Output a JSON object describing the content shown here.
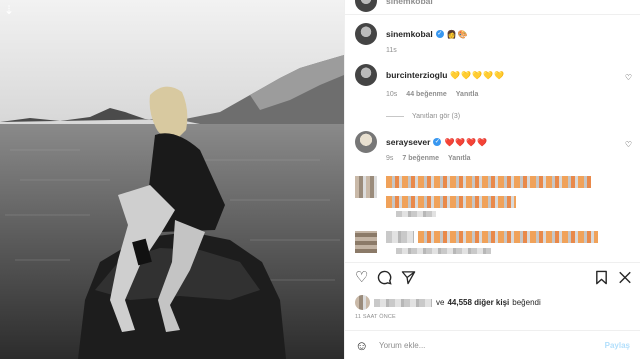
{
  "post": {
    "author": "sinemkobal",
    "author_badges": "👩🎨",
    "caption_time": "11s",
    "top_partial_user": "sinemkobal"
  },
  "comments": [
    {
      "user": "burcinterzioglu",
      "text": "💛💛💛💛💛",
      "time": "10s",
      "likes": "44 beğenme",
      "reply": "Yanıtla",
      "view_replies": "Yanıtları gör (3)"
    },
    {
      "user": "seraysever",
      "text": "❤️❤️❤️❤️",
      "time": "9s",
      "likes": "7 beğenme",
      "reply": "Yanıtla"
    }
  ],
  "actions": {
    "like_icon": "heart-icon",
    "comment_icon": "comment-icon",
    "share_icon": "share-icon",
    "save_icon": "bookmark-icon"
  },
  "likes_summary": {
    "prefix": "ve",
    "count_text": "44,558 diğer kişi",
    "suffix": "beğendi"
  },
  "timestamp": "11 SAAT ÖNCE",
  "comment_input": {
    "placeholder": "Yorum ekle...",
    "post_label": "Paylaş"
  },
  "colors": {
    "verified": "#3897f0",
    "post_disabled": "#b2dffc",
    "muted_text": "#8e8e8e"
  }
}
